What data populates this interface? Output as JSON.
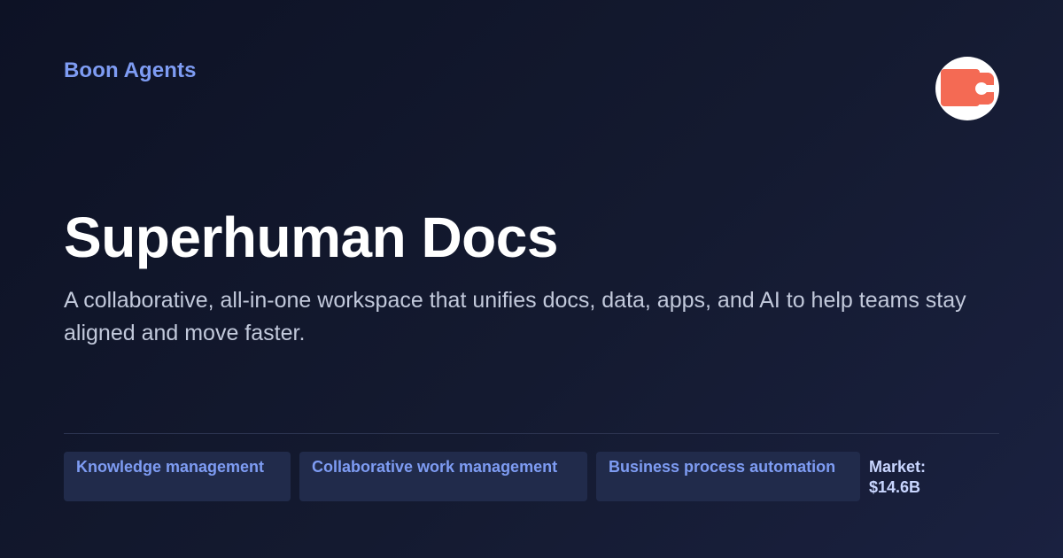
{
  "header": {
    "brand": "Boon Agents",
    "logo_icon": "coda-logo-icon",
    "logo_color": "#f46a54"
  },
  "hero": {
    "title": "Superhuman Docs",
    "description": "A collaborative, all-in-one workspace that unifies docs, data, apps, and AI to help teams stay aligned and move faster."
  },
  "tags": [
    {
      "label": "Knowledge management"
    },
    {
      "label": "Collaborative work management"
    },
    {
      "label": "Business process automation"
    }
  ],
  "market": {
    "label": "Market:",
    "value": "$14.6B"
  },
  "colors": {
    "accent": "#7e9cf3",
    "tag_background": "#212b4b",
    "background": "#0d1225"
  }
}
